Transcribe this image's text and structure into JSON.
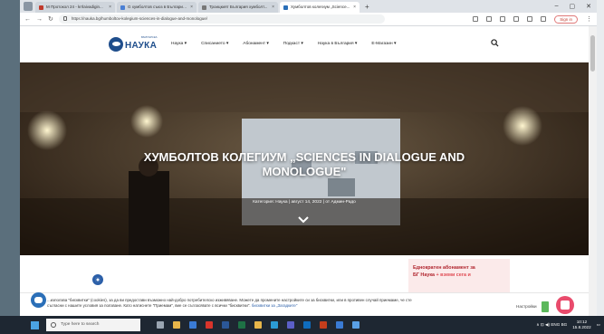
{
  "browser": {
    "tabs": [
      {
        "title": "M  Протокол 24 - krrlaivadigin...",
        "active": false,
        "fav_color": "#c0392b"
      },
      {
        "title": "G  хумболтов съюз в България - С...",
        "active": false,
        "fav_color": "#4a7fd4"
      },
      {
        "title": "Троицкият България хумболт...",
        "active": false,
        "fav_color": "#777777"
      },
      {
        "title": "Хумболтов колегиум „Science...",
        "active": true,
        "fav_color": "#2b6fb8"
      }
    ],
    "new_tab": "+",
    "window_controls": [
      "–",
      "▢",
      "✕"
    ],
    "url": "https://nauka.bg/humboltov-kolegium-sciences-in-dialogue-and-monologue/",
    "signin_label": "Sign in"
  },
  "site": {
    "logo_text": "НАУКА",
    "logo_sub": "БЪЛГАРСКА",
    "menu": [
      "Наука ▾",
      "Списанието ▾",
      "Абонамент ▾",
      "Подкаст ▾",
      "Наука в България ▾",
      "Е-Магазин ▾"
    ]
  },
  "article": {
    "title_line1": "ХУМБОЛТОВ КОЛЕГИУМ „SCIENCES IN DIALOGUE AND",
    "title_line2": "MONOLOGUE\"",
    "category": "Категория: Наука",
    "date": "| август 14, 2022",
    "author": "| от Админ-Радо"
  },
  "subscription": {
    "line1": "Еднократен абонамент за",
    "line2": "БГ Наука",
    "line2_accent": "+ вземи сега и"
  },
  "cookie": {
    "text": "...използва \"бисквитки\" (cookies), за да ви предостави възможно най-добро потребителско изживяване. Можете да промените настройките си за бисквитки, или в противен случай приемаме, че сте съгласни с нашите условия за ползване. Като натиснете \"Приемам\", вие се съгласявате с всички \"бисквитки\".",
    "link": "бисквитки за „Загадките\"",
    "settings": "Настройки"
  },
  "taskbar": {
    "search_placeholder": "Type here to search",
    "apps": [
      {
        "name": "task-view",
        "color": "#9aa5b1"
      },
      {
        "name": "file-explorer",
        "color": "#e8b64a"
      },
      {
        "name": "mail",
        "color": "#3a7bd5"
      },
      {
        "name": "acrobat",
        "color": "#d9342b"
      },
      {
        "name": "word",
        "color": "#2b5797"
      },
      {
        "name": "excel",
        "color": "#1e7145"
      },
      {
        "name": "chrome",
        "color": "#e8b64a"
      },
      {
        "name": "edge",
        "color": "#2b9bd5"
      },
      {
        "name": "teams",
        "color": "#5b5fc7"
      },
      {
        "name": "outlook",
        "color": "#0f6cbd"
      },
      {
        "name": "powerpoint",
        "color": "#c43e1c"
      },
      {
        "name": "photos",
        "color": "#3a7bd5"
      },
      {
        "name": "onedrive",
        "color": "#5aa0e6"
      }
    ],
    "tray_text": "∧  ⊡  ◀)  ENG  BG",
    "time": "10:12",
    "date": "15.8.2022"
  }
}
